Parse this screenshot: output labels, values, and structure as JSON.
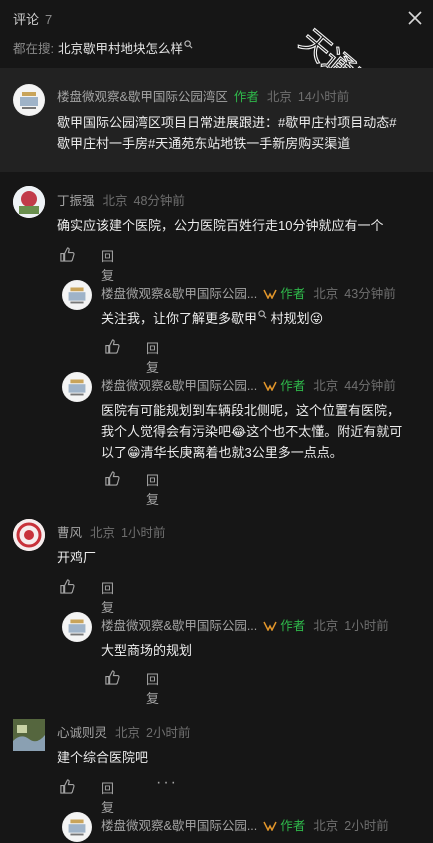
{
  "header": {
    "title": "评论",
    "count": "7",
    "close_icon": "close-icon"
  },
  "search": {
    "prefix": "都在搜:",
    "term": "北京歇甲村地块怎么样"
  },
  "watermark": {
    "text": "天通苑社区网"
  },
  "pinned": {
    "author": "楼盘微观察&歇甲国际公园湾区",
    "author_badge": "作者",
    "location": "北京",
    "time": "14小时前",
    "text_line1": "歇甲国际公园湾区项目日常进展跟进：#歇甲庄村项目动态#",
    "text_line2": "歇甲庄村一手房#天通苑东站地铁一手新房购买渠道"
  },
  "comments": [
    {
      "user": "丁振强",
      "location": "北京",
      "time": "48分钟前",
      "text": "确实应该建个医院，公力医院百姓行走10分钟就应有一个",
      "reply_label": "回复",
      "replies": [
        {
          "user": "楼盘微观察&歇甲国际公园...",
          "badge": "作者",
          "location": "北京",
          "time": "43分钟前",
          "text": "关注我，让你了解更多歇甲",
          "text_tail": "村规划😜",
          "reply_label": "回复"
        },
        {
          "user": "楼盘微观察&歇甲国际公园...",
          "badge": "作者",
          "location": "北京",
          "time": "44分钟前",
          "lines": [
            "医院有可能规划到车辆段北侧呢，这个位置有医院，",
            "我个人觉得会有污染吧😂这个也不太懂。附近有就可",
            "以了😁清华长庚离着也就3公里多一点点。"
          ],
          "reply_label": "回复"
        }
      ]
    },
    {
      "user": "曹风",
      "location": "北京",
      "time": "1小时前",
      "text": "开鸡厂",
      "reply_label": "回复",
      "replies": [
        {
          "user": "楼盘微观察&歇甲国际公园...",
          "badge": "作者",
          "location": "北京",
          "time": "1小时前",
          "text": "大型商场的规划",
          "reply_label": "回复"
        }
      ]
    },
    {
      "user": "心诚则灵",
      "location": "北京",
      "time": "2小时前",
      "text": "建个综合医院吧",
      "reply_label": "回复",
      "more": "···",
      "replies": [
        {
          "user": "楼盘微观察&歇甲国际公园...",
          "badge": "作者",
          "location": "北京",
          "time": "2小时前"
        }
      ]
    }
  ],
  "colors": {
    "background": "#161616",
    "pinned_bg": "#222222",
    "author_green": "#2fb84a",
    "muted": "#6f6f6f"
  }
}
